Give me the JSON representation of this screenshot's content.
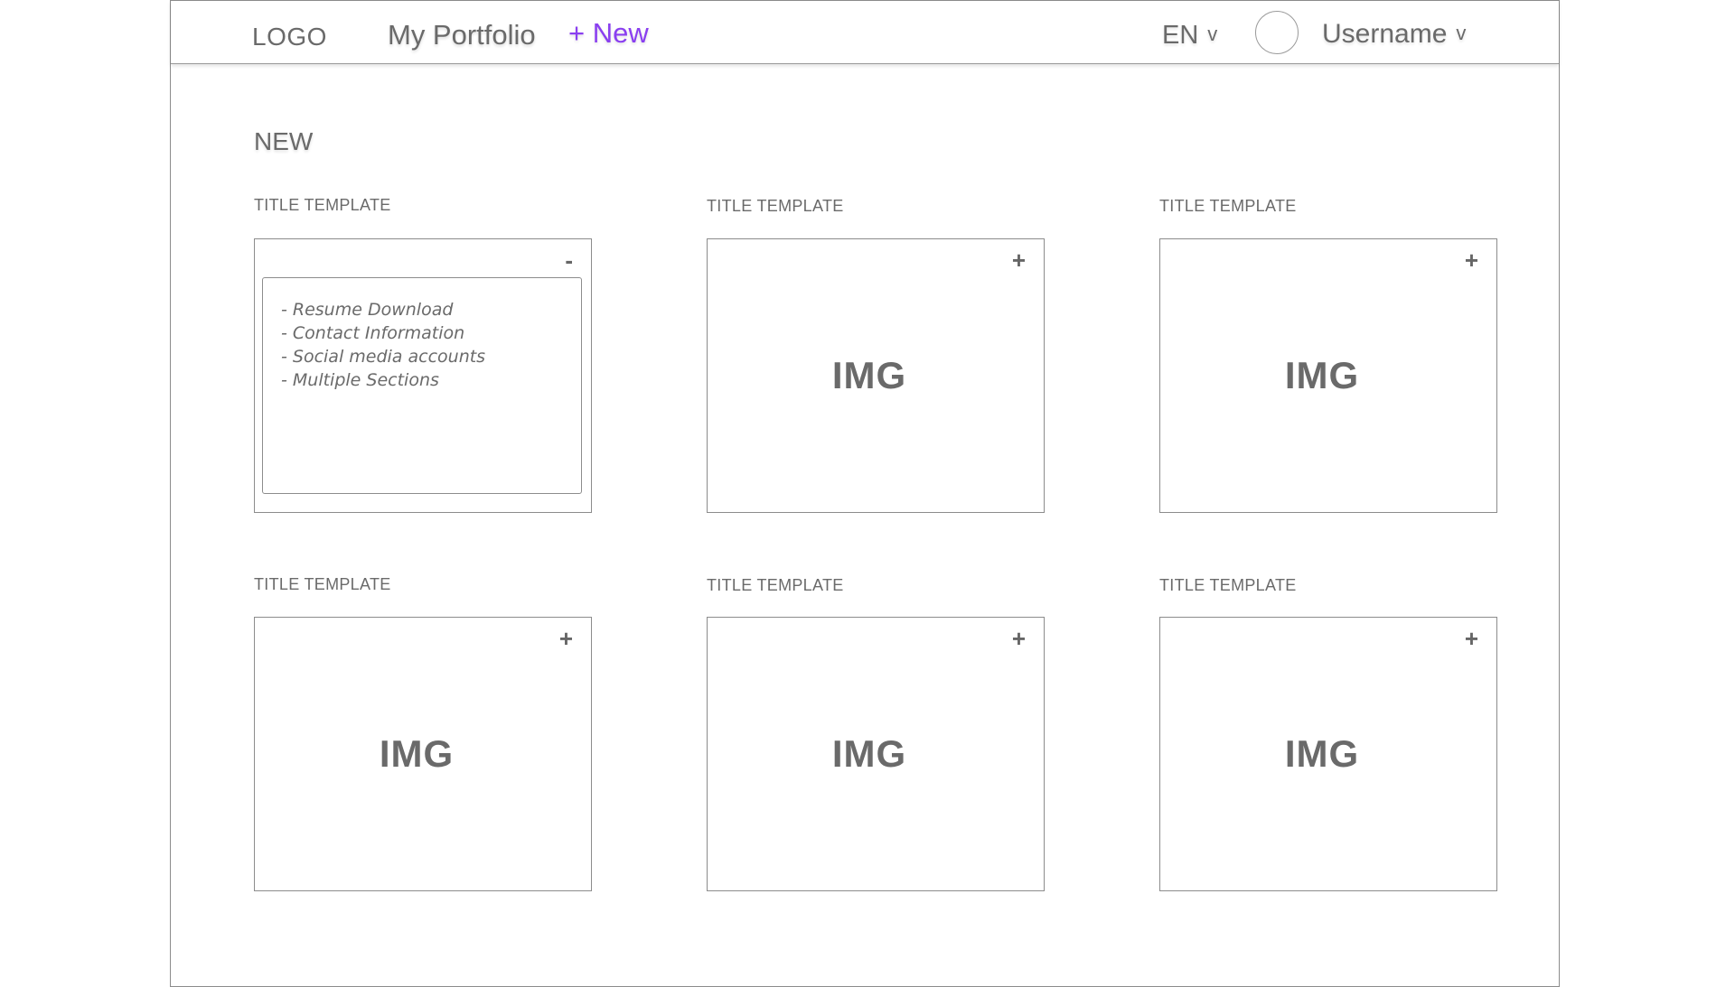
{
  "header": {
    "logo": "LOGO",
    "nav_portfolio": "My Portfolio",
    "nav_new": "+ New",
    "language": "EN",
    "language_chevron": "v",
    "username": "Username",
    "username_chevron": "v"
  },
  "main": {
    "section_title": "NEW",
    "cards": [
      {
        "title": "TITLE TEMPLATE",
        "toggle": "-",
        "expanded": true,
        "features": [
          "- Resume Download",
          "- Contact Information",
          "- Social media accounts",
          "- Multiple Sections"
        ]
      },
      {
        "title": "TITLE TEMPLATE",
        "toggle": "+",
        "expanded": false,
        "image_label": "IMG"
      },
      {
        "title": "TITLE TEMPLATE",
        "toggle": "+",
        "expanded": false,
        "image_label": "IMG"
      },
      {
        "title": "TITLE TEMPLATE",
        "toggle": "+",
        "expanded": false,
        "image_label": "IMG"
      },
      {
        "title": "TITLE TEMPLATE",
        "toggle": "+",
        "expanded": false,
        "image_label": "IMG"
      },
      {
        "title": "TITLE TEMPLATE",
        "toggle": "+",
        "expanded": false,
        "image_label": "IMG"
      }
    ]
  },
  "colors": {
    "accent": "#8a3ff0",
    "text": "#6a6a6a",
    "border": "#8c8c8c"
  }
}
